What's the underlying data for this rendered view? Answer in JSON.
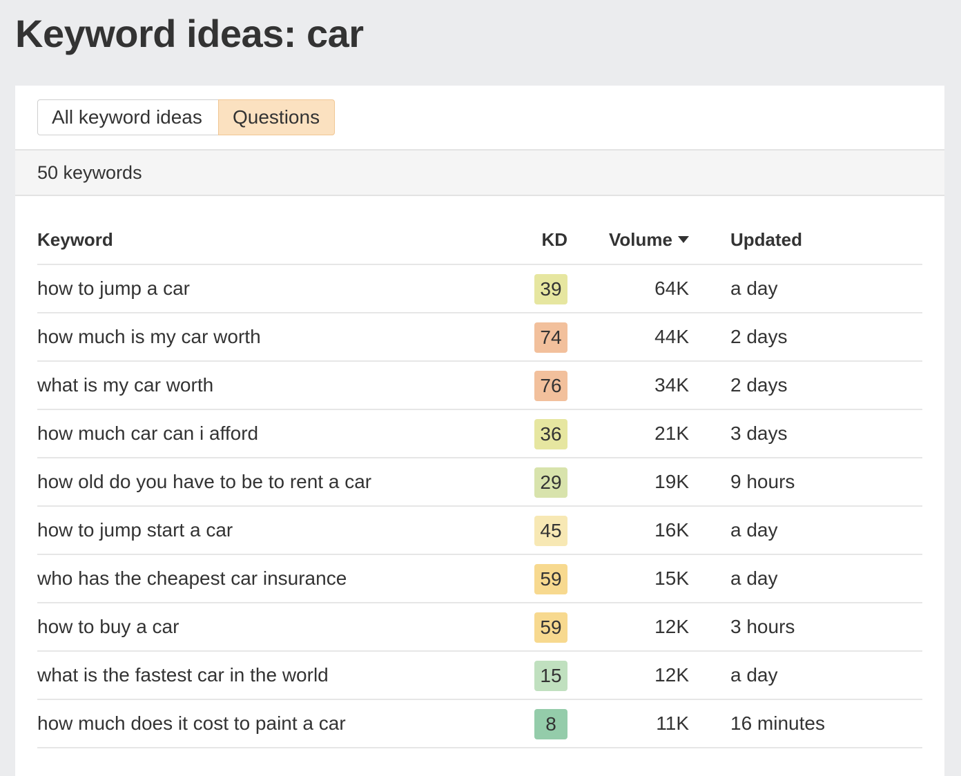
{
  "page": {
    "title": "Keyword ideas: car"
  },
  "tabs": [
    {
      "label": "All keyword ideas",
      "active": false
    },
    {
      "label": "Questions",
      "active": true
    }
  ],
  "summary": {
    "count_text": "50 keywords"
  },
  "table": {
    "columns": {
      "keyword": "Keyword",
      "kd": "KD",
      "volume": "Volume",
      "updated": "Updated"
    },
    "sort": {
      "column": "volume",
      "direction": "desc"
    },
    "rows": [
      {
        "keyword": "how to jump a car",
        "kd": "39",
        "kd_color": "#e6e6a0",
        "volume": "64K",
        "updated": "a day"
      },
      {
        "keyword": "how much is my car worth",
        "kd": "74",
        "kd_color": "#f2c09c",
        "volume": "44K",
        "updated": "2 days"
      },
      {
        "keyword": "what is my car worth",
        "kd": "76",
        "kd_color": "#f2c09c",
        "volume": "34K",
        "updated": "2 days"
      },
      {
        "keyword": "how much car can i afford",
        "kd": "36",
        "kd_color": "#e6e6a0",
        "volume": "21K",
        "updated": "3 days"
      },
      {
        "keyword": "how old do you have to be to rent a car",
        "kd": "29",
        "kd_color": "#d8e3ac",
        "volume": "19K",
        "updated": "9 hours"
      },
      {
        "keyword": "how to jump start a car",
        "kd": "45",
        "kd_color": "#f7e8b4",
        "volume": "16K",
        "updated": "a day"
      },
      {
        "keyword": "who has the cheapest car insurance",
        "kd": "59",
        "kd_color": "#f7d98f",
        "volume": "15K",
        "updated": "a day"
      },
      {
        "keyword": "how to buy a car",
        "kd": "59",
        "kd_color": "#f7d98f",
        "volume": "12K",
        "updated": "3 hours"
      },
      {
        "keyword": "what is the fastest car in the world",
        "kd": "15",
        "kd_color": "#c0e0bf",
        "volume": "12K",
        "updated": "a day"
      },
      {
        "keyword": "how much does it cost to paint a car",
        "kd": "8",
        "kd_color": "#94ccaa",
        "volume": "11K",
        "updated": "16 minutes"
      }
    ]
  }
}
